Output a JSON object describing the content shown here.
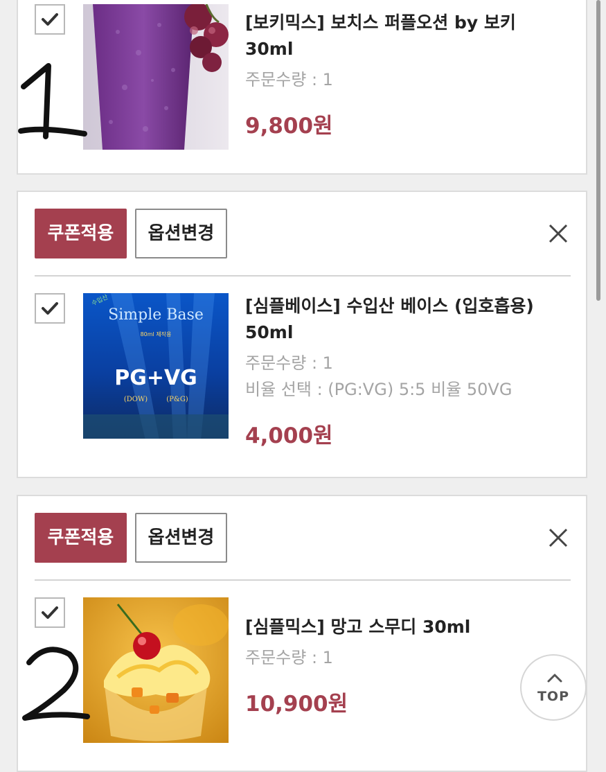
{
  "cart": {
    "coupon_label": "쿠폰적용",
    "option_label": "옵션변경",
    "quantity_label": "주문수량 : 1",
    "items": [
      {
        "title_line1": "[보키믹스] 보치스 퍼플오션 by 보키",
        "title_line2": "30ml",
        "quantity": "주문수량 : 1",
        "price": "9,800원",
        "image": "purple grape drink"
      },
      {
        "title_line1": "[심플베이스] 수입산 베이스 (입호흡용)",
        "title_line2": "50ml",
        "quantity": "주문수량 : 1",
        "option": "비율 선택 : (PG:VG) 5:5 비율 50VG",
        "price": "4,000원",
        "image": "Simple Base PG+VG bottle art",
        "image_text": {
          "brand": "Simple Base",
          "sub": "80ml 제작용",
          "main": "PG+VG",
          "left": "(DOW)",
          "right": "(P&G)",
          "corner": "수입산"
        }
      },
      {
        "title_line1": "[심플믹스] 망고 스무디 30ml",
        "quantity": "주문수량 : 1",
        "price": "10,900원",
        "image": "mango smoothie with cherry"
      }
    ],
    "annotations": [
      "1",
      "2"
    ]
  },
  "top_button": {
    "label": "TOP"
  },
  "colors": {
    "accent": "#a4404f",
    "background": "#efefef",
    "card": "#ffffff",
    "meta_text": "#a4a4a4"
  }
}
